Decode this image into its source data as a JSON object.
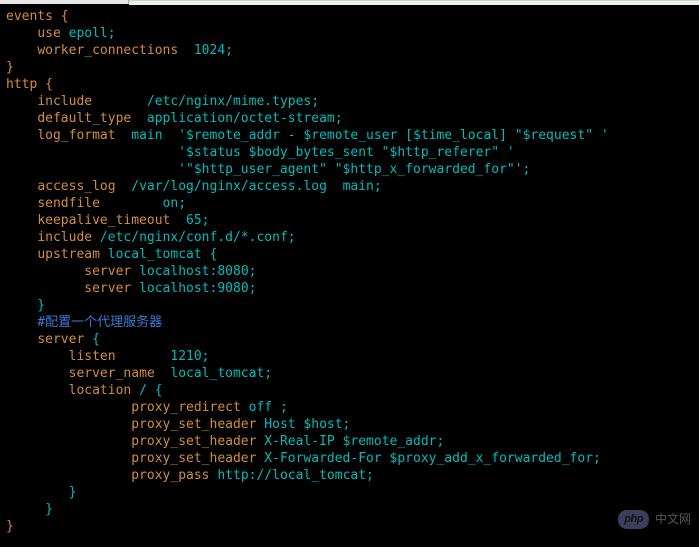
{
  "config": {
    "l01": "events {",
    "l02a": "    ",
    "l02b": "use",
    " ": "",
    "l02c": " epoll;",
    "l03a": "    ",
    "l03b": "worker_connections",
    "l03c": "  1024;",
    "l04": "}",
    "l05": "http {",
    "l06a": "    ",
    "l06b": "include",
    "l06c": "       /etc/nginx/mime.types;",
    "l07a": "    ",
    "l07b": "default_type",
    "l07c": "  application/octet-stream;",
    "l08a": "    ",
    "l08b": "log_format",
    "l08c": "  main  '$remote_addr - $remote_user [$time_local] \"$request\" '",
    "l09": "                      '$status $body_bytes_sent \"$http_referer\" '",
    "l10": "                      '\"$http_user_agent\" \"$http_x_forwarded_for\"';",
    "l11a": "    ",
    "l11b": "access_log",
    "l11c": "  /var/log/nginx/access.log  main;",
    "l12a": "    ",
    "l12b": "sendfile",
    "l12c": "        on;",
    "l13a": "    ",
    "l13b": "keepalive_timeout",
    "l13c": "  65;",
    "l14a": "    ",
    "l14b": "include",
    "l14c": " /etc/nginx/conf.d/*.conf;",
    "l15a": "    ",
    "l15b": "upstream",
    "l15c": " local_tomcat {",
    "l16a": "          ",
    "l16b": "server",
    "l16c": " localhost:8080;",
    "l17a": "          ",
    "l17b": "server",
    "l17c": " localhost:9080;",
    "l18": "    }",
    "l19": "    #配置一个代理服务器",
    "l20a": "    ",
    "l20b": "server",
    "l20c": " {",
    "l21a": "        ",
    "l21b": "listen",
    "l21c": "       1210;",
    "l22a": "        ",
    "l22b": "server_name",
    "l22c": "  local_tomcat;",
    "l23a": "        ",
    "l23b": "location",
    "l23c": " / {",
    "l24a": "                ",
    "l24b": "proxy_redirect",
    "l24c": " off ;",
    "l25a": "                ",
    "l25b": "proxy_set_header",
    "l25c": " Host $host;",
    "l26a": "                ",
    "l26b": "proxy_set_header",
    "l26c": " X-Real-IP $remote_addr;",
    "l27a": "                ",
    "l27b": "proxy_set_header",
    "l27c": " X-Forwarded-For $proxy_add_x_forwarded_for;",
    "l28a": "                ",
    "l28b": "proxy_pass",
    "l28c": " http://local_tomcat;",
    "l29": "        }",
    "l30": "     }",
    "l31": "}"
  },
  "watermark": {
    "php": "php",
    "site": "中文网"
  }
}
